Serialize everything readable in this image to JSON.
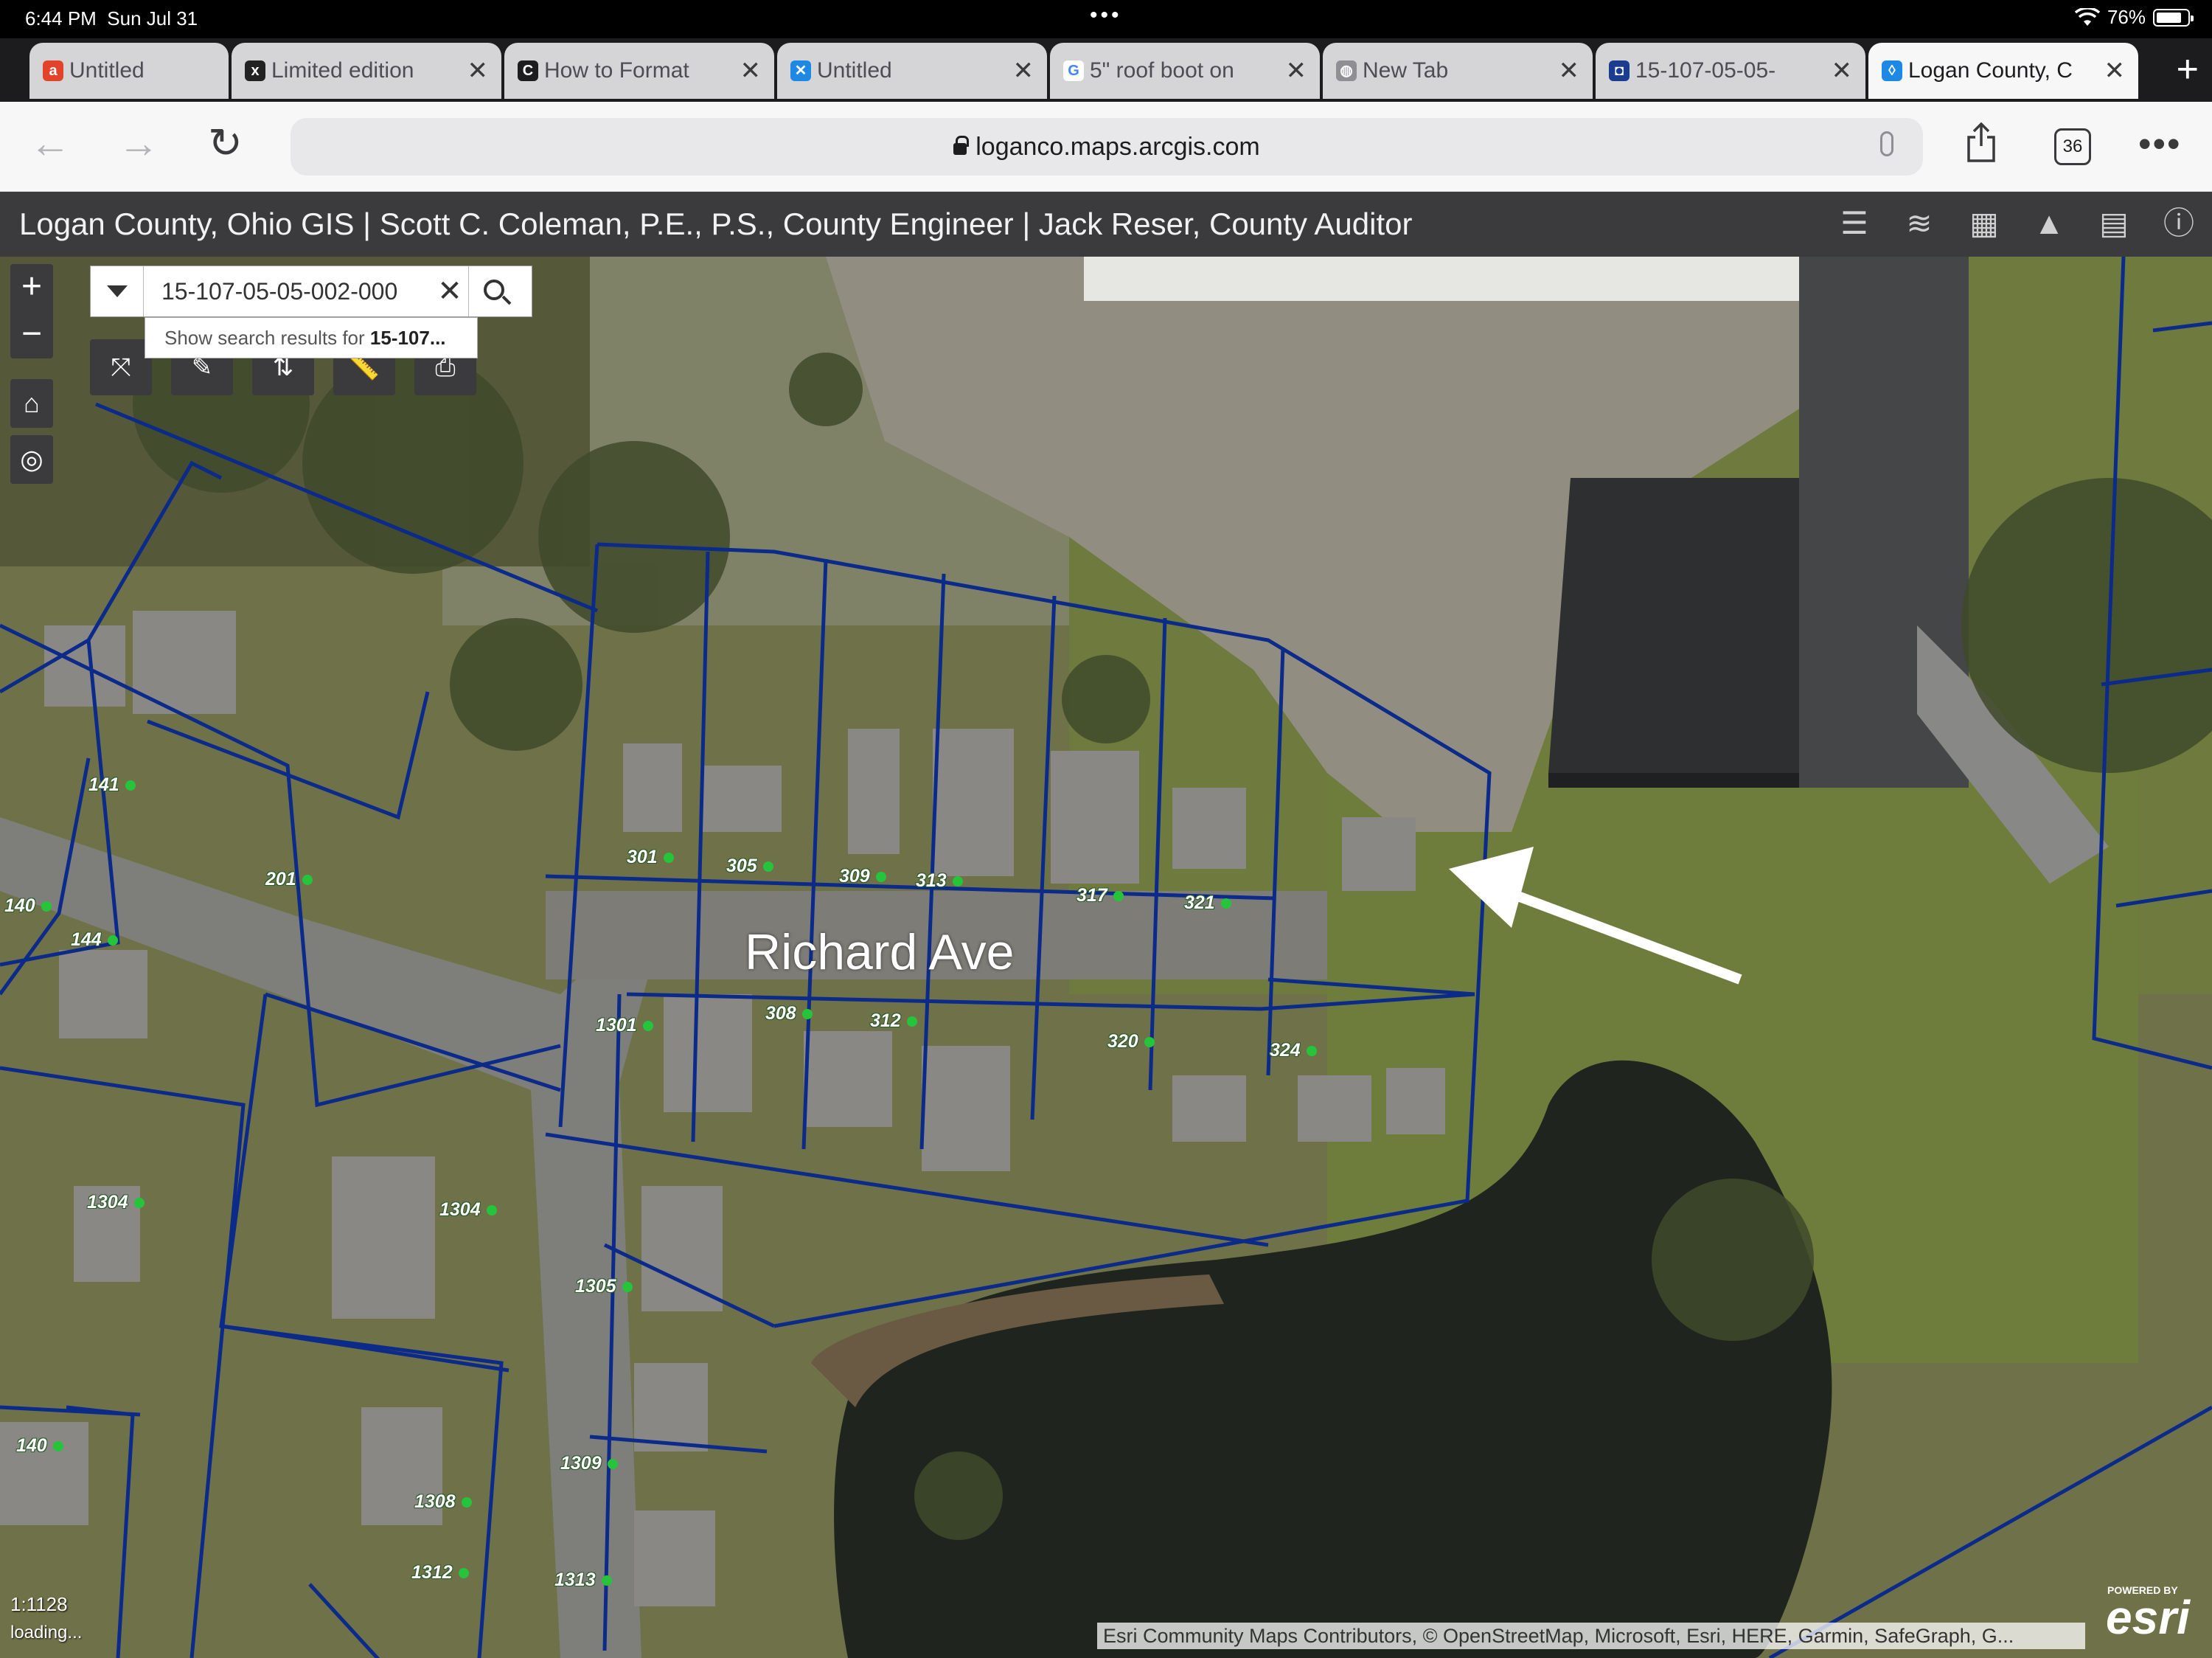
{
  "status": {
    "time": "6:44 PM",
    "date": "Sun Jul 31",
    "battery": "76%"
  },
  "tabs": [
    {
      "label": "Untitled",
      "favicon": "a",
      "color": "#e4432b"
    },
    {
      "label": "Limited edition",
      "favicon": "x",
      "color": "#222222"
    },
    {
      "label": "How to Format",
      "favicon": "C",
      "color": "#1d1d1f"
    },
    {
      "label": "Untitled",
      "favicon": "✕",
      "color": "#1e88e5"
    },
    {
      "label": "5\" roof boot on",
      "favicon": "G",
      "color": "#4285f4"
    },
    {
      "label": "New Tab",
      "favicon": "◍",
      "color": "#8e8e93"
    },
    {
      "label": "15-107-05-05-",
      "favicon": "◘",
      "color": "#1a3d8f"
    },
    {
      "label": "Logan County, C",
      "favicon": "◊",
      "color": "#1e88e5",
      "active": true
    }
  ],
  "browser": {
    "url": "loganco.maps.arcgis.com",
    "tab_count": "36"
  },
  "gis": {
    "title": "Logan County, Ohio GIS  |  Scott C. Coleman, P.E., P.S., County Engineer  |  Jack Reser, County Auditor"
  },
  "search": {
    "value": "15-107-05-05-002-000",
    "suggest_prefix": "Show search results for ",
    "suggest_term": "15-107..."
  },
  "map": {
    "street": "Richard Ave",
    "scale": "1:1128",
    "loading": "loading...",
    "attribution": "Esri Community Maps Contributors, © OpenStreetMap, Microsoft, Esri, HERE, Garmin, SafeGraph, G...",
    "brand_small": "POWERED BY",
    "brand": "esri",
    "addresses": [
      "141",
      "201",
      "140",
      "144",
      "301",
      "305",
      "309",
      "313",
      "317",
      "321",
      "1301",
      "308",
      "312",
      "320",
      "324",
      "1304",
      "1304",
      "1305",
      "140",
      "1309",
      "1308",
      "1312",
      "1313"
    ],
    "parcel_color": "#0b2a8a"
  }
}
